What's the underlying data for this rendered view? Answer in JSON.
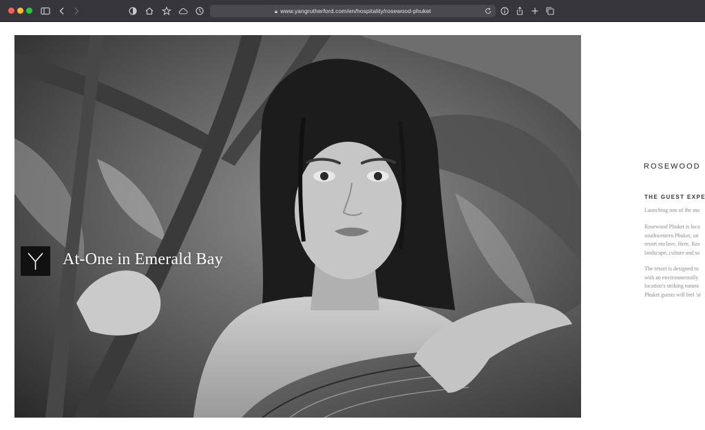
{
  "browser": {
    "url": "www.yangrutherford.com/en/hospitality/rosewood-phuket",
    "icons": [
      "close-dot",
      "minimize-dot",
      "zoom-dot",
      "sidebar-icon",
      "back-icon",
      "forward-icon",
      "shield-icon",
      "home-icon",
      "star-icon",
      "cloud-icon",
      "history-icon",
      "lock-icon",
      "reload-icon",
      "info-icon",
      "share-icon",
      "new-tab-icon",
      "tabs-icon"
    ]
  },
  "hero": {
    "title": "At-One in Emerald Bay",
    "logo_icon": "y-monogram-icon"
  },
  "side_panel": {
    "brand": "ROSEWOOD",
    "heading": "THE GUEST EXPER",
    "paragraph1": [
      "Launching one of the mo"
    ],
    "paragraph2": [
      "Rosewood Phuket is loca",
      "southwestern Phuket, on",
      "resort enclave. Here, Ros",
      "landscape, culture and so"
    ],
    "paragraph3": [
      "The resort is designed to",
      "with an environmentally",
      "location's striking natura",
      "Phuket guests will feel 'at"
    ]
  }
}
